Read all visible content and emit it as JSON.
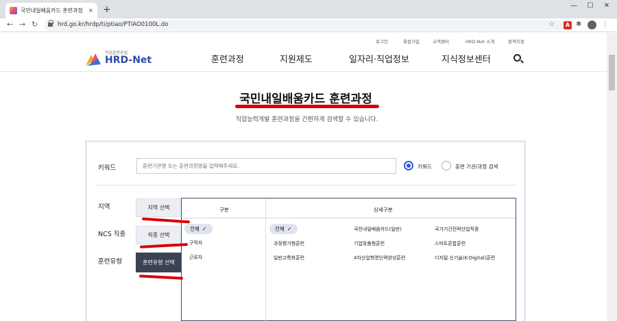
{
  "browser": {
    "tab_title": "국민내일배움카드 훈련과정 | HR",
    "tab_close": "×",
    "new_tab": "+",
    "url": "hrd.go.kr/hrdp/ti/ptiao/PTIAO0100L.do",
    "back": "←",
    "forward": "→",
    "reload": "↻",
    "minimize": "—",
    "maximize": "☐",
    "close": "✕",
    "star": "☆",
    "pdf": "A",
    "puzzle": "✱",
    "menu": "⋮"
  },
  "site": {
    "logo_small": "직업훈련포털",
    "logo_big": "HRD-Net",
    "util_links": [
      "로그인",
      "회원가입",
      "고객센터",
      "HRD-Net 소개",
      "원격지원"
    ],
    "gnb": [
      "훈련과정",
      "지원제도",
      "일자리·직업정보",
      "지식정보센터"
    ]
  },
  "main": {
    "title": "국민내일배움카드 훈련과정",
    "subtitle": "직업능력개발 훈련과정을 간편하게 검색할 수 있습니다."
  },
  "search": {
    "keyword_label": "키워드",
    "keyword_placeholder": "훈련기관명 또는 훈련과정명을 입력해주세요.",
    "radio_keyword": "키워드",
    "radio_org": "훈련 기관/과정 검색",
    "region_label": "지역",
    "region_button": "지역 선택",
    "ncs_label": "NCS 직종",
    "ncs_button": "직종 선택",
    "type_label": "훈련유형",
    "type_button": "훈련유형 선택"
  },
  "panel": {
    "col_category": "구분",
    "col_detail": "상세구분",
    "categories": [
      "전체",
      "구직자",
      "근로자"
    ],
    "details": [
      [
        "전체",
        "국민내일배움카드(일반)",
        "국가기간전략산업직종"
      ],
      [
        "과정평가형훈련",
        "기업맞춤형훈련",
        "스마트혼합훈련"
      ],
      [
        "일반고특화훈련",
        "4차산업혁명인력양성훈련",
        "디지털 신기술(K-Digital)훈련"
      ]
    ],
    "check": "✓"
  },
  "colors": {
    "accent": "#2d5bd6",
    "annotation_red": "#d90000",
    "active_button": "#3a4352"
  }
}
